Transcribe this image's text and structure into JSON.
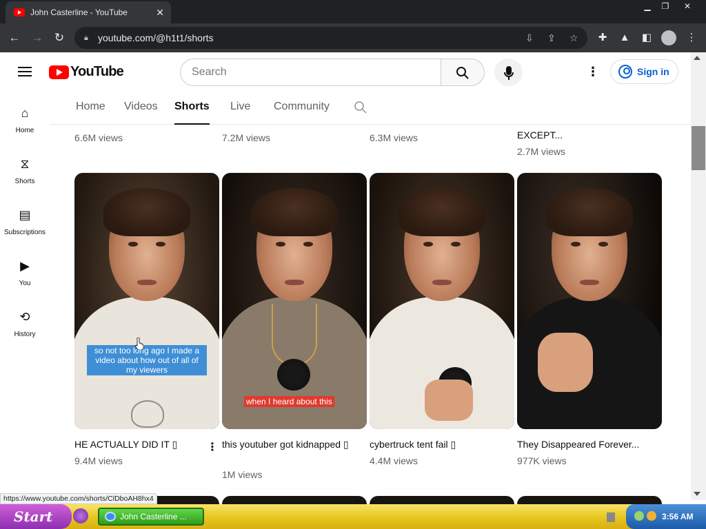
{
  "browser": {
    "tab_title": "John Casterline - YouTube",
    "tab_close": "✕",
    "url": "youtube.com/@h1t1/shorts",
    "status_url": "https://www.youtube.com/shorts/ClDboAH8hx4"
  },
  "window_controls": {
    "minimize": "▁",
    "restore": "❐",
    "close": "✕"
  },
  "header": {
    "logo_text": "YouTube",
    "search_placeholder": "Search",
    "signin_label": "Sign in"
  },
  "rail": [
    {
      "label": "Home",
      "icon": "home-icon"
    },
    {
      "label": "Shorts",
      "icon": "shorts-icon"
    },
    {
      "label": "Subscriptions",
      "icon": "subscriptions-icon"
    },
    {
      "label": "You",
      "icon": "you-icon"
    },
    {
      "label": "History",
      "icon": "history-icon"
    }
  ],
  "channel_tabs": [
    "Home",
    "Videos",
    "Shorts",
    "Live",
    "Community"
  ],
  "active_tab": "Shorts",
  "prev_row": [
    {
      "title": "",
      "views": "6.6M views"
    },
    {
      "title": "",
      "views": "7.2M views"
    },
    {
      "title": "",
      "views": "6.3M views"
    },
    {
      "title": "EXCEPT...",
      "views": "2.7M views"
    }
  ],
  "shorts": [
    {
      "title": "HE ACTUALLY DID IT ▯",
      "views": "9.4M views",
      "caption": "so not too long ago I made a video about how out of all of my viewers",
      "shirt": "#e9e4dc"
    },
    {
      "title": "this youtuber got kidnapped ▯",
      "views": "1M views",
      "caption": "when I heard about this",
      "shirt": "#8a7a6a"
    },
    {
      "title": "cybertruck tent fail ▯",
      "views": "4.4M views",
      "caption": "",
      "shirt": "#ece8e0"
    },
    {
      "title": "They Disappeared Forever...",
      "views": "977K views",
      "caption": "",
      "shirt": "#151515"
    }
  ],
  "taskbar": {
    "start_label": "Start",
    "task_label": "John Casterline ...",
    "clock": "3:56 AM"
  },
  "colors": {
    "yt_red": "#ff0000",
    "signin_blue": "#065fd4",
    "caption_blue": "#3f8fd6",
    "caption_red": "#e03a2f"
  }
}
